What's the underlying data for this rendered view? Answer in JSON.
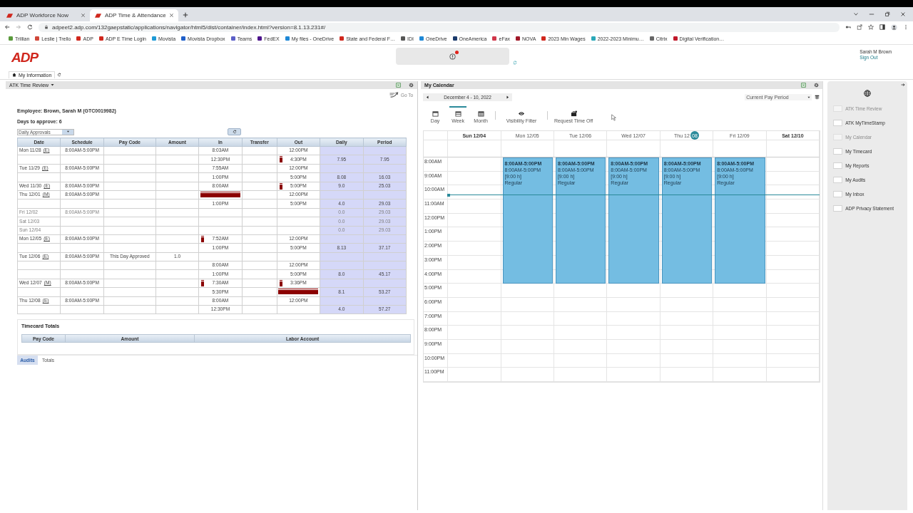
{
  "browser": {
    "tabs": [
      {
        "title": "ADP Workforce Now",
        "selected": false
      },
      {
        "title": "ADP Time & Attendance",
        "selected": true
      }
    ],
    "url": "adpeet2.adp.com/132gaepstatic/applications/navigator/html5/dist/container/index.html?version=8.1.13.231#/",
    "bookmarks": [
      {
        "label": "Trillian",
        "color": "#5a9a3c"
      },
      {
        "label": "Leslie | Trello",
        "color": "#d0473a"
      },
      {
        "label": "ADP",
        "color": "#d0271d"
      },
      {
        "label": "ADP E Time Login",
        "color": "#d0271d"
      },
      {
        "label": "Movista",
        "color": "#1e9ad6"
      },
      {
        "label": "Movista Dropbox",
        "color": "#1f5fc9"
      },
      {
        "label": "Teams",
        "color": "#5b5fc7"
      },
      {
        "label": "FedEX",
        "color": "#4d148c"
      },
      {
        "label": "My files - OneDrive",
        "color": "#1e88d6"
      },
      {
        "label": "State and Federal F…",
        "color": "#d0271d"
      },
      {
        "label": "IDI",
        "color": "#555555"
      },
      {
        "label": "OneDrive",
        "color": "#1e88d6"
      },
      {
        "label": "OneAmerica",
        "color": "#1b3a6b"
      },
      {
        "label": "eFax",
        "color": "#d0374a"
      },
      {
        "label": "NOVA",
        "color": "#a01828"
      },
      {
        "label": "2023 Min Wages",
        "color": "#d0271d"
      },
      {
        "label": "2022-2023 Minimu…",
        "color": "#2aa8b8"
      },
      {
        "label": "Citrix",
        "color": "#666666"
      },
      {
        "label": "Digital Verification…",
        "color": "#c0182a"
      }
    ]
  },
  "header": {
    "logo": "ADP",
    "user": "Sarah M Brown",
    "sign_out": "Sign Out",
    "app_tab": "My Information"
  },
  "time_review": {
    "title": "ATK Time Review",
    "go_to": "Go To",
    "employee": "Employee: Brown, Sarah M (GTC0019982)",
    "days_to_approve": "Days to approve: 6",
    "view": "Daily Approvals",
    "columns": [
      "Date",
      "Schedule",
      "Pay Code",
      "Amount",
      "In",
      "Transfer",
      "Out",
      "Daily",
      "Period"
    ],
    "rows": [
      {
        "date": "Mon 11/28",
        "tag": "(E)",
        "dim": false,
        "schedule": "8:00AM-5:00PM",
        "pay_code": "",
        "amount": "",
        "in": "8:03AM",
        "in_flag": false,
        "in_bar": false,
        "out": "12:00PM",
        "out_flag": false,
        "out_bar": false,
        "daily": "",
        "period": ""
      },
      {
        "date": "",
        "tag": "",
        "dim": false,
        "schedule": "",
        "pay_code": "",
        "amount": "",
        "in": "12:30PM",
        "in_flag": false,
        "in_bar": false,
        "out": "4:30PM",
        "out_flag": true,
        "out_bar": false,
        "daily": "7.95",
        "period": "7.95"
      },
      {
        "date": "Tue 11/29",
        "tag": "(E)",
        "dim": false,
        "schedule": "8:00AM-5:00PM",
        "pay_code": "",
        "amount": "",
        "in": "7:55AM",
        "in_flag": false,
        "in_bar": false,
        "out": "12:00PM",
        "out_flag": false,
        "out_bar": false,
        "daily": "",
        "period": ""
      },
      {
        "date": "",
        "tag": "",
        "dim": false,
        "schedule": "",
        "pay_code": "",
        "amount": "",
        "in": "1:00PM",
        "in_flag": false,
        "in_bar": false,
        "out": "5:00PM",
        "out_flag": false,
        "out_bar": false,
        "daily": "8.08",
        "period": "16.03"
      },
      {
        "date": "Wed 11/30",
        "tag": "(E)",
        "dim": false,
        "schedule": "8:00AM-5:00PM",
        "pay_code": "",
        "amount": "",
        "in": "8:00AM",
        "in_flag": false,
        "in_bar": false,
        "out": "5:00PM",
        "out_flag": true,
        "out_bar": false,
        "daily": "9.0",
        "period": "25.03"
      },
      {
        "date": "Thu 12/01",
        "tag": "(M)",
        "dim": false,
        "schedule": "8:00AM-5:00PM",
        "pay_code": "",
        "amount": "",
        "in": "",
        "in_flag": false,
        "in_bar": true,
        "out": "12:00PM",
        "out_flag": false,
        "out_bar": false,
        "daily": "",
        "period": ""
      },
      {
        "date": "",
        "tag": "",
        "dim": false,
        "schedule": "",
        "pay_code": "",
        "amount": "",
        "in": "1:00PM",
        "in_flag": false,
        "in_bar": false,
        "out": "5:00PM",
        "out_flag": false,
        "out_bar": false,
        "daily": "4.0",
        "period": "29.03"
      },
      {
        "date": "Fri 12/02",
        "tag": "",
        "dim": true,
        "schedule": "8:00AM-5:00PM",
        "pay_code": "",
        "amount": "",
        "in": "",
        "in_flag": false,
        "in_bar": false,
        "out": "",
        "out_flag": false,
        "out_bar": false,
        "daily": "0.0",
        "period": "29.03"
      },
      {
        "date": "Sat 12/03",
        "tag": "",
        "dim": true,
        "schedule": "",
        "pay_code": "",
        "amount": "",
        "in": "",
        "in_flag": false,
        "in_bar": false,
        "out": "",
        "out_flag": false,
        "out_bar": false,
        "daily": "0.0",
        "period": "29.03"
      },
      {
        "date": "Sun 12/04",
        "tag": "",
        "dim": true,
        "schedule": "",
        "pay_code": "",
        "amount": "",
        "in": "",
        "in_flag": false,
        "in_bar": false,
        "out": "",
        "out_flag": false,
        "out_bar": false,
        "daily": "0.0",
        "period": "29.03"
      },
      {
        "date": "Mon 12/05",
        "tag": "(E)",
        "dim": false,
        "schedule": "8:00AM-5:00PM",
        "pay_code": "",
        "amount": "",
        "in": "7:52AM",
        "in_flag": true,
        "in_bar": false,
        "out": "12:00PM",
        "out_flag": false,
        "out_bar": false,
        "daily": "",
        "period": ""
      },
      {
        "date": "",
        "tag": "",
        "dim": false,
        "schedule": "",
        "pay_code": "",
        "amount": "",
        "in": "1:00PM",
        "in_flag": false,
        "in_bar": false,
        "out": "5:00PM",
        "out_flag": false,
        "out_bar": false,
        "daily": "8.13",
        "period": "37.17"
      },
      {
        "date": "Tue 12/06",
        "tag": "(E)",
        "dim": false,
        "schedule": "8:00AM-5:00PM",
        "pay_code": "This Day Approved",
        "amount": "1.0",
        "in": "",
        "in_flag": false,
        "in_bar": false,
        "out": "",
        "out_flag": false,
        "out_bar": false,
        "daily": "",
        "period": ""
      },
      {
        "date": "",
        "tag": "",
        "dim": false,
        "schedule": "",
        "pay_code": "",
        "amount": "",
        "in": "8:00AM",
        "in_flag": false,
        "in_bar": false,
        "out": "12:00PM",
        "out_flag": false,
        "out_bar": false,
        "daily": "",
        "period": ""
      },
      {
        "date": "",
        "tag": "",
        "dim": false,
        "schedule": "",
        "pay_code": "",
        "amount": "",
        "in": "1:00PM",
        "in_flag": false,
        "in_bar": false,
        "out": "5:00PM",
        "out_flag": false,
        "out_bar": false,
        "daily": "8.0",
        "period": "45.17"
      },
      {
        "date": "Wed 12/07",
        "tag": "(M)",
        "dim": false,
        "schedule": "8:00AM-5:00PM",
        "pay_code": "",
        "amount": "",
        "in": "7:30AM",
        "in_flag": true,
        "in_bar": false,
        "out": "3:36PM",
        "out_flag": true,
        "out_bar": false,
        "daily": "",
        "period": ""
      },
      {
        "date": "",
        "tag": "",
        "dim": false,
        "schedule": "",
        "pay_code": "",
        "amount": "",
        "in": "5:30PM",
        "in_flag": false,
        "in_bar": false,
        "out": "",
        "out_flag": false,
        "out_bar": true,
        "daily": "8.1",
        "period": "53.27"
      },
      {
        "date": "Thu 12/08",
        "tag": "(E)",
        "dim": false,
        "schedule": "8:00AM-5:00PM",
        "pay_code": "",
        "amount": "",
        "in": "8:00AM",
        "in_flag": false,
        "in_bar": false,
        "out": "12:00PM",
        "out_flag": false,
        "out_bar": false,
        "daily": "",
        "period": ""
      },
      {
        "date": "",
        "tag": "",
        "dim": false,
        "schedule": "",
        "pay_code": "",
        "amount": "",
        "in": "12:30PM",
        "in_flag": false,
        "in_bar": false,
        "out": "",
        "out_flag": false,
        "out_bar": false,
        "daily": "4.0",
        "period": "57.27"
      }
    ],
    "totals_title": "Timecard Totals",
    "totals_columns": [
      "Pay Code",
      "Amount",
      "Labor Account"
    ],
    "tabs": [
      {
        "label": "Audits",
        "selected": true
      },
      {
        "label": "Totals",
        "selected": false
      }
    ]
  },
  "calendar": {
    "title": "My Calendar",
    "range": "December 4 - 10, 2022",
    "period": "Current Pay Period",
    "views": [
      {
        "label": "Day",
        "selected": false
      },
      {
        "label": "Week",
        "selected": true
      },
      {
        "label": "Month",
        "selected": false
      }
    ],
    "tools": [
      {
        "label": "Visibility Filter",
        "kind": "eye"
      },
      {
        "label": "Request Time Off",
        "kind": "suitcase"
      }
    ],
    "days": [
      {
        "label": "Sun 12/04",
        "bold": true
      },
      {
        "label": "Mon 12/05",
        "bold": false,
        "event": {
          "title": "8:00AM-5:00PM",
          "time": "8:00AM-5:00PM",
          "hours": "[9:00 h]",
          "type": "Regular"
        }
      },
      {
        "label": "Tue 12/06",
        "bold": false,
        "event": {
          "title": "8:00AM-5:00PM",
          "time": "8:00AM-5:00PM",
          "hours": "[9:00 h]",
          "type": "Regular"
        }
      },
      {
        "label": "Wed 12/07",
        "bold": false,
        "event": {
          "title": "8:00AM-5:00PM",
          "time": "8:00AM-5:00PM",
          "hours": "[9:00 h]",
          "type": "Regular"
        }
      },
      {
        "label": "Thu 12",
        "badge": "08",
        "bold": false,
        "event": {
          "title": "8:00AM-5:00PM",
          "time": "8:00AM-5:00PM",
          "hours": "[9:00 h]",
          "type": "Regular"
        }
      },
      {
        "label": "Fri 12/09",
        "bold": false,
        "event": {
          "title": "8:00AM-5:00PM",
          "time": "8:00AM-5:00PM",
          "hours": "[9:00 h]",
          "type": "Regular"
        }
      },
      {
        "label": "Sat 12/10",
        "bold": true
      }
    ],
    "hours": [
      "8:00AM",
      "9:00AM",
      "10:00AM",
      "11:00AM",
      "12:00PM",
      "1:00PM",
      "2:00PM",
      "3:00PM",
      "4:00PM",
      "5:00PM",
      "6:00PM",
      "7:00PM",
      "8:00PM",
      "9:00PM",
      "10:00PM",
      "11:00PM"
    ]
  },
  "sidebar": {
    "items": [
      {
        "label": "ATK Time Review",
        "disabled": true
      },
      {
        "label": "ATK MyTimeStamp",
        "disabled": false
      },
      {
        "label": "My Calendar",
        "disabled": true
      },
      {
        "label": "My Timecard",
        "disabled": false
      },
      {
        "label": "My Reports",
        "disabled": false
      },
      {
        "label": "My Audits",
        "disabled": false
      },
      {
        "label": "My Inbox",
        "disabled": false
      },
      {
        "label": "ADP Privacy Statement",
        "disabled": false
      }
    ]
  }
}
